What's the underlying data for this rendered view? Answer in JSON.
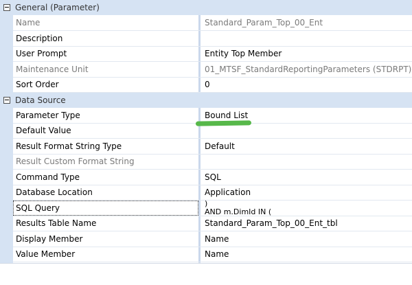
{
  "categories": {
    "general": "General (Parameter)",
    "datasource": "Data Source"
  },
  "rows": {
    "name": {
      "label": "Name",
      "value": "Standard_Param_Top_00_Ent"
    },
    "description": {
      "label": "Description",
      "value": ""
    },
    "user_prompt": {
      "label": "User Prompt",
      "value": "Entity Top Member"
    },
    "maintenance_unit": {
      "label": "Maintenance Unit",
      "value": "01_MTSF_StandardReportingParameters (STDRPT)"
    },
    "sort_order": {
      "label": "Sort Order",
      "value": "0"
    },
    "parameter_type": {
      "label": "Parameter Type",
      "value": "Bound List"
    },
    "default_value": {
      "label": "Default Value",
      "value": ""
    },
    "result_format_string_type": {
      "label": "Result Format String Type",
      "value": "Default"
    },
    "result_custom_format_string": {
      "label": "Result Custom Format String",
      "value": ""
    },
    "command_type": {
      "label": "Command Type",
      "value": "SQL"
    },
    "database_location": {
      "label": "Database Location",
      "value": "Application"
    },
    "sql_query": {
      "label": "SQL Query",
      "value_line1": ")",
      "value_line2": "AND m.DimId IN ("
    },
    "results_table_name": {
      "label": "Results Table Name",
      "value": "Standard_Param_Top_00_Ent_tbl"
    },
    "display_member": {
      "label": "Display Member",
      "value": "Name"
    },
    "value_member": {
      "label": "Value Member",
      "value": "Name"
    }
  },
  "icons": {
    "collapse": "minus-box-icon"
  },
  "colors": {
    "category_bg": "#d6e3f3",
    "highlight_mark": "#57b84a"
  }
}
